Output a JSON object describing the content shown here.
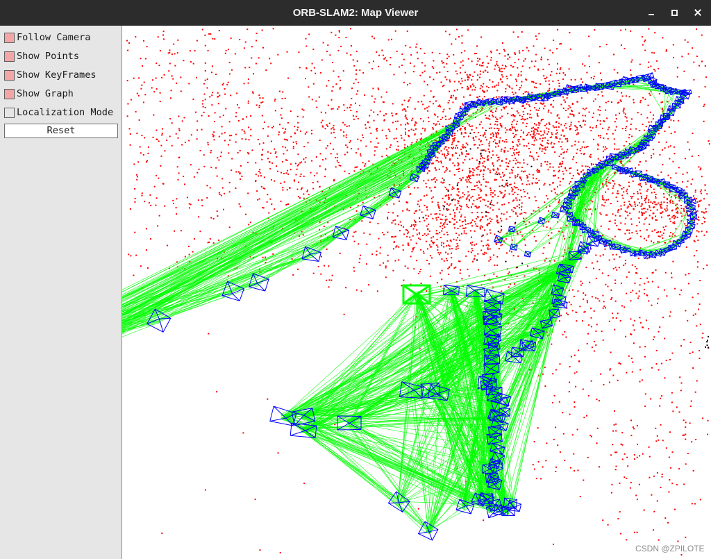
{
  "window": {
    "title": "ORB-SLAM2: Map Viewer",
    "controls": [
      "minimize-icon",
      "maximize-icon",
      "close-icon"
    ]
  },
  "panel": {
    "options": [
      {
        "label": "Follow Camera",
        "checked": true
      },
      {
        "label": "Show Points",
        "checked": true
      },
      {
        "label": "Show KeyFrames",
        "checked": true
      },
      {
        "label": "Show Graph",
        "checked": true
      },
      {
        "label": "Localization Mode",
        "checked": false
      }
    ],
    "reset_label": "Reset",
    "colors": {
      "background": "#e6e6e6",
      "checkbox_checked": "#f3a6a6",
      "checkbox_unchecked": "#e6e6e6"
    }
  },
  "map": {
    "colors": {
      "background": "#ffffff",
      "map_points": "#ff0000",
      "reference_points": "#000000",
      "keyframes": "#0000ff",
      "covisibility_graph": "#00ff00",
      "current_camera": "#00ff00"
    }
  },
  "watermark": "CSDN @ZPILOTE"
}
